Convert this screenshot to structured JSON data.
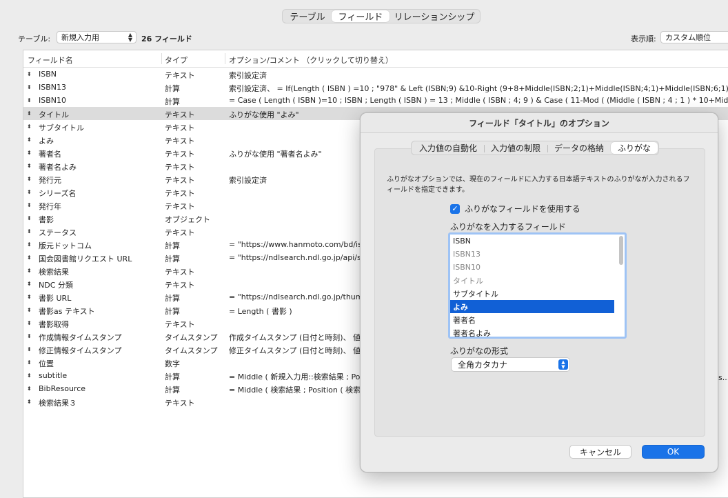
{
  "top_tabs": [
    "テーブル",
    "フィールド",
    "リレーションシップ"
  ],
  "toolbar": {
    "table_label": "テーブル:",
    "table_value": "新規入力用",
    "field_count": "26 フィールド",
    "sort_label": "表示順:",
    "sort_value": "カスタム順位"
  },
  "table": {
    "headers": {
      "name": "フィールド名",
      "type": "タイプ",
      "options": "オプション/コメント  （クリックして切り替え）"
    },
    "rows": [
      {
        "name": "ISBN",
        "type": "テキスト",
        "options": "索引設定済"
      },
      {
        "name": "ISBN13",
        "type": "計算",
        "options": "索引設定済、 = If(Length ( ISBN )   =10 ; \"978\" & Left (ISBN;9)  &10-Right (9+8+Middle(ISBN;2;1)+Middle(ISBN;4;1)+Middle(ISBN;6;1)+Middle(..."
      },
      {
        "name": "ISBN10",
        "type": "計算",
        "options": "= Case  ( Length ( ISBN )=10 ; ISBN ; Length ( ISBN ) = 13 ;   Middle ( ISBN ; 4; 9 )  & Case ( 11-Mod ( (Middle ( ISBN ; 4 ; 1 ) * 10+Middle ( I..."
      },
      {
        "name": "タイトル",
        "type": "テキスト",
        "options": "ふりがな使用 \"よみ\""
      },
      {
        "name": "サブタイトル",
        "type": "テキスト",
        "options": ""
      },
      {
        "name": "よみ",
        "type": "テキスト",
        "options": ""
      },
      {
        "name": "著者名",
        "type": "テキスト",
        "options": "ふりがな使用 \"著者名よみ\""
      },
      {
        "name": "著者名よみ",
        "type": "テキスト",
        "options": ""
      },
      {
        "name": "発行元",
        "type": "テキスト",
        "options": "索引設定済"
      },
      {
        "name": "シリーズ名",
        "type": "テキスト",
        "options": ""
      },
      {
        "name": "発行年",
        "type": "テキスト",
        "options": ""
      },
      {
        "name": "書影",
        "type": "オブジェクト",
        "options": ""
      },
      {
        "name": "ステータス",
        "type": "テキスト",
        "options": ""
      },
      {
        "name": "版元ドットコム",
        "type": "計算",
        "options": "= \"https://www.hanmoto.com/bd/isbn"
      },
      {
        "name": "国会図書館リクエスト URL",
        "type": "計算",
        "options": "= \"https://ndlsearch.ndl.go.jp/api/sru"
      },
      {
        "name": "検索結果",
        "type": "テキスト",
        "options": ""
      },
      {
        "name": "NDC 分類",
        "type": "テキスト",
        "options": ""
      },
      {
        "name": "書影 URL",
        "type": "計算",
        "options": "= \"https://ndlsearch.ndl.go.jp/thumb"
      },
      {
        "name": "書影as テキスト",
        "type": "計算",
        "options": "= Length ( 書影 )"
      },
      {
        "name": "書影取得",
        "type": "テキスト",
        "options": ""
      },
      {
        "name": "作成情報タイムスタンプ",
        "type": "タイムスタンプ",
        "options": "作成タイムスタンプ (日付と時刻)、 値変更"
      },
      {
        "name": "修正情報タイムスタンプ",
        "type": "タイムスタンプ",
        "options": "修正タイムスタンプ (日付と時刻)、 値変更"
      },
      {
        "name": "位置",
        "type": "数字",
        "options": ""
      },
      {
        "name": "subtitle",
        "type": "計算",
        "options": "= Middle ( 新規入力用::検索結果 ; Positi"
      },
      {
        "name": "BibResource",
        "type": "計算",
        "options": "= Middle ( 検索結果 ; Position ( 検索結果"
      },
      {
        "name": "検索結果３",
        "type": "テキスト",
        "options": ""
      }
    ],
    "overflow_fragment": "s..."
  },
  "dialog": {
    "title": "フィールド「タイトル」のオプション",
    "tabs": [
      "入力値の自動化",
      "入力値の制限",
      "データの格納",
      "ふりがな"
    ],
    "description": "ふりがなオプションでは、現在のフィールドに入力する日本語テキストのふりがなが入力されるフィールドを指定できます。",
    "use_furigana_label": "ふりがなフィールドを使用する",
    "use_furigana_checked": true,
    "field_list_label": "ふりがなを入力するフィールド",
    "field_list": [
      {
        "label": "ISBN",
        "state": "normal"
      },
      {
        "label": "ISBN13",
        "state": "dim"
      },
      {
        "label": "ISBN10",
        "state": "dim"
      },
      {
        "label": "タイトル",
        "state": "dim"
      },
      {
        "label": "サブタイトル",
        "state": "normal"
      },
      {
        "label": "よみ",
        "state": "selected"
      },
      {
        "label": "著者名",
        "state": "normal"
      },
      {
        "label": "著者名よみ",
        "state": "normal"
      }
    ],
    "format_label": "ふりがなの形式",
    "format_value": "全角カタカナ",
    "cancel_label": "キャンセル",
    "ok_label": "OK"
  },
  "colors": {
    "accent": "#1a73e8",
    "selection": "#1160d6",
    "row_selected": "#dcdcdc"
  }
}
